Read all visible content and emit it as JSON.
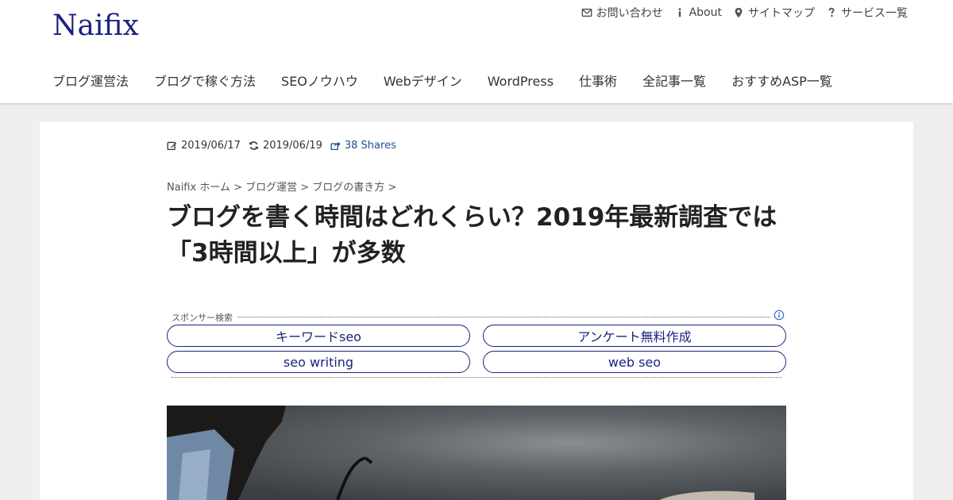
{
  "site": {
    "logo": "Naifix"
  },
  "topnav": [
    {
      "icon": "envelope-icon",
      "label": "お問い合わせ"
    },
    {
      "icon": "info-icon",
      "label": "About"
    },
    {
      "icon": "map-marker-icon",
      "label": "サイトマップ"
    },
    {
      "icon": "question-icon",
      "label": "サービス一覧"
    }
  ],
  "mainnav": [
    "ブログ運営法",
    "ブログで稼ぐ方法",
    "SEOノウハウ",
    "Webデザイン",
    "WordPress",
    "仕事術",
    "全記事一覧",
    "おすすめASP一覧"
  ],
  "article": {
    "published": "2019/06/17",
    "updated": "2019/06/19",
    "shares": "38 Shares",
    "breadcrumb": [
      "Naifix ホーム",
      "ブログ運営",
      "ブログの書き方"
    ],
    "title": "ブログを書く時間はどれくらい？2019年最新調査では「3時間以上」が多数"
  },
  "ads": {
    "label": "スポンサー検索",
    "items": [
      "キーワードseo",
      "アンケート無料作成",
      "seo writing",
      "web seo"
    ]
  },
  "colors": {
    "brand": "#1a237e",
    "link": "#1e4f91"
  }
}
